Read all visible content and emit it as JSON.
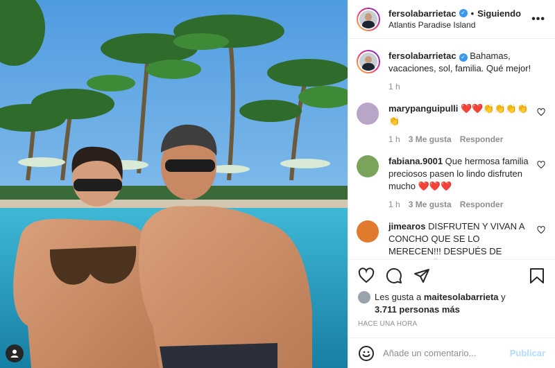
{
  "post": {
    "username": "fersolabarrietac",
    "follow_label": "Siguiendo",
    "separator": "•",
    "location": "Atlantis Paradise Island",
    "more_label": "•••",
    "verified_mark": "✓",
    "caption": "Bahamas, vacaciones, sol, familia. Qué mejor!",
    "caption_time": "1 h"
  },
  "comments": [
    {
      "username": "marypanguipulli",
      "text": "❤️❤️👏👏👏👏👏",
      "time": "1 h",
      "likes": "3 Me gusta",
      "reply": "Responder",
      "avatar_color": "#b9a5c7"
    },
    {
      "username": "fabiana.9001",
      "text": "Que hermosa familia preciosos pasen lo lindo disfruten mucho ❤️❤️❤️",
      "time": "1 h",
      "likes": "3 Me gusta",
      "reply": "Responder",
      "avatar_color": "#7aa35b"
    },
    {
      "username": "jimearos",
      "text": "DISFRUTEN Y VIVAN A CONCHO QUE SE LO MERECEN!!! DESPUÉS DE TANTOS AÑOS",
      "avatar_color": "#e07a2c"
    }
  ],
  "likes": {
    "prefix": "Les gusta a",
    "user": "maitesolabarrieta",
    "conj": "y",
    "count": "3.711 personas más"
  },
  "time_label": "HACE UNA HORA",
  "add_comment": {
    "placeholder": "Añade un comentario...",
    "publish": "Publicar"
  },
  "icons": {
    "like": "heart-icon",
    "comment": "comment-icon",
    "share": "share-icon",
    "save": "bookmark-icon",
    "emoji": "emoji-icon",
    "tags": "user-tag-icon"
  },
  "colors": {
    "verified": "#3897f0",
    "publish": "#b3dbff",
    "muted": "#8e8e8e"
  }
}
